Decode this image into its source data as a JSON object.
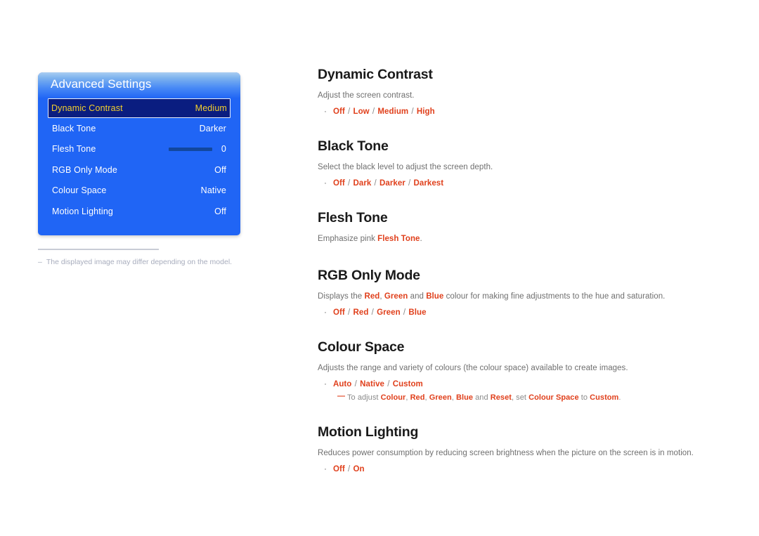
{
  "osd": {
    "title": "Advanced Settings",
    "rows": [
      {
        "label": "Dynamic Contrast",
        "value": "Medium",
        "selected": true,
        "type": "value"
      },
      {
        "label": "Black Tone",
        "value": "Darker",
        "selected": false,
        "type": "value"
      },
      {
        "label": "Flesh Tone",
        "value": "0",
        "selected": false,
        "type": "slider"
      },
      {
        "label": "RGB Only Mode",
        "value": "Off",
        "selected": false,
        "type": "value"
      },
      {
        "label": "Colour Space",
        "value": "Native",
        "selected": false,
        "type": "value"
      },
      {
        "label": "Motion Lighting",
        "value": "Off",
        "selected": false,
        "type": "value"
      }
    ]
  },
  "footnote": {
    "dash": "–",
    "text": "The displayed image may differ depending on the model."
  },
  "sections": [
    {
      "title": "Dynamic Contrast",
      "desc": "Adjust the screen contrast.",
      "options": [
        "Off",
        "Low",
        "Medium",
        "High"
      ]
    },
    {
      "title": "Black Tone",
      "desc": "Select the black level to adjust the screen depth.",
      "options": [
        "Off",
        "Dark",
        "Darker",
        "Darkest"
      ]
    },
    {
      "title": "Flesh Tone",
      "desc_parts": [
        {
          "t": "Emphasize pink ",
          "hl": false
        },
        {
          "t": "Flesh Tone",
          "hl": true
        },
        {
          "t": ".",
          "hl": false
        }
      ],
      "options": []
    },
    {
      "title": "RGB Only Mode",
      "desc_parts": [
        {
          "t": "Displays the ",
          "hl": false
        },
        {
          "t": "Red",
          "hl": true
        },
        {
          "t": ", ",
          "hl": false
        },
        {
          "t": "Green",
          "hl": true
        },
        {
          "t": " and ",
          "hl": false
        },
        {
          "t": "Blue",
          "hl": true
        },
        {
          "t": " colour for making fine adjustments to the hue and saturation.",
          "hl": false
        }
      ],
      "options": [
        "Off",
        "Red",
        "Green",
        "Blue"
      ]
    },
    {
      "title": "Colour Space",
      "desc": "Adjusts the range and variety of colours (the colour space) available to create images.",
      "options": [
        "Auto",
        "Native",
        "Custom"
      ],
      "note": {
        "dash": "—",
        "parts": [
          {
            "t": "To adjust ",
            "hl": false
          },
          {
            "t": "Colour",
            "hl": true
          },
          {
            "t": ", ",
            "hl": false
          },
          {
            "t": "Red",
            "hl": true
          },
          {
            "t": ", ",
            "hl": false
          },
          {
            "t": "Green",
            "hl": true
          },
          {
            "t": ", ",
            "hl": false
          },
          {
            "t": "Blue",
            "hl": true
          },
          {
            "t": " and ",
            "hl": false
          },
          {
            "t": "Reset",
            "hl": true
          },
          {
            "t": ", set ",
            "hl": false
          },
          {
            "t": "Colour Space",
            "hl": true
          },
          {
            "t": " to ",
            "hl": false
          },
          {
            "t": "Custom",
            "hl": true
          },
          {
            "t": ".",
            "hl": false
          }
        ]
      }
    },
    {
      "title": "Motion Lighting",
      "desc": "Reduces power consumption by reducing screen brightness when the picture on the screen is in motion.",
      "options": [
        "Off",
        "On"
      ]
    }
  ],
  "colors": {
    "osd_blue": "#2065f5",
    "osd_selected_bg": "#0a1d80",
    "osd_selected_text": "#f3cf2c",
    "option_red": "#e0401c",
    "heading": "#1a1a1a",
    "body_text": "#6f6f6f",
    "footnote_text": "#a8adbd"
  },
  "bullet_glyph": "·"
}
